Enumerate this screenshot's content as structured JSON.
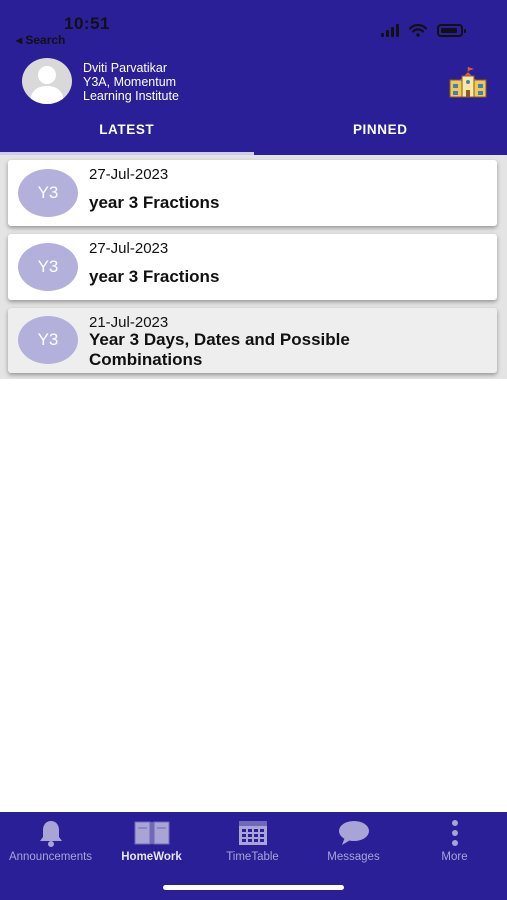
{
  "status_bar": {
    "time": "10:51",
    "back_label": "◂ Search",
    "icons": [
      "cellular-signal-icon",
      "wifi-icon",
      "battery-icon"
    ]
  },
  "profile": {
    "name": "Dviti Parvatikar",
    "class_line": "Y3A, Momentum",
    "school_line": "Learning Institute",
    "avatar_icon": "user-avatar-icon",
    "school_icon": "school-building-icon"
  },
  "tabs": [
    {
      "label": "LATEST",
      "active": true
    },
    {
      "label": "PINNED",
      "active": false
    }
  ],
  "items": [
    {
      "badge": "Y3",
      "date": "27-Jul-2023",
      "title": "year 3 Fractions"
    },
    {
      "badge": "Y3",
      "date": "27-Jul-2023",
      "title": "year 3 Fractions"
    },
    {
      "badge": "Y3",
      "date": "21-Jul-2023",
      "title_line1": "Year 3 Days, Dates and Possible",
      "title_line2": "Combinations"
    }
  ],
  "bottom_nav": [
    {
      "label": "Announcements",
      "icon": "bell-icon",
      "active": false
    },
    {
      "label": "HomeWork",
      "icon": "book-icon",
      "active": true
    },
    {
      "label": "TimeTable",
      "icon": "calendar-grid-icon",
      "active": false
    },
    {
      "label": "Messages",
      "icon": "chat-bubble-icon",
      "active": false
    },
    {
      "label": "More",
      "icon": "more-vertical-icon",
      "active": false
    }
  ],
  "colors": {
    "primary": "#2a1f96",
    "badge": "#b3b0dc",
    "nav_inactive": "#a9a4d6",
    "list_background": "#e4e4e4"
  }
}
